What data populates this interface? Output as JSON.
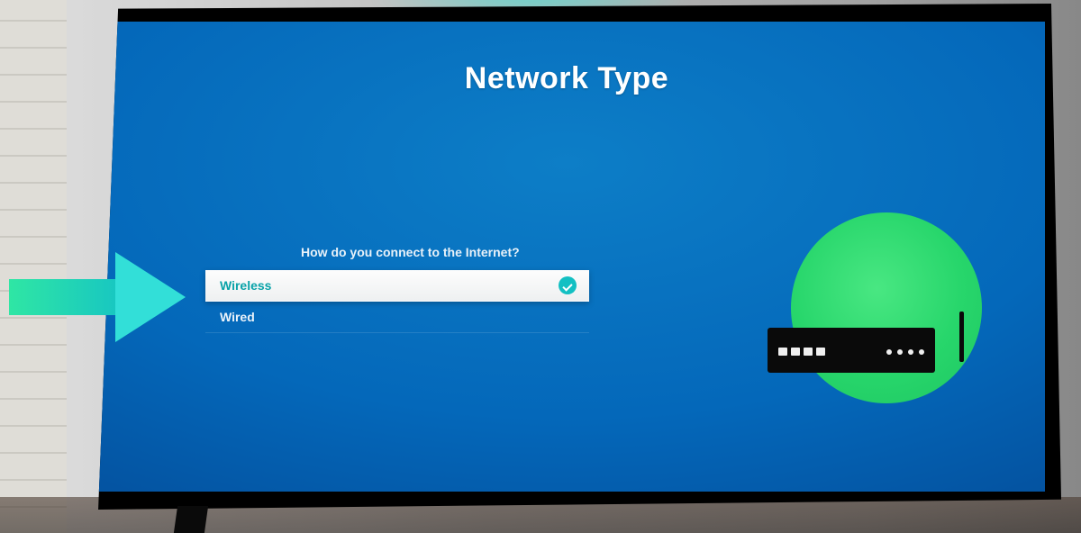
{
  "header": {
    "title": "Network Type"
  },
  "prompt": "How do you connect to the Internet?",
  "options": [
    {
      "label": "Wireless",
      "selected": true
    },
    {
      "label": "Wired",
      "selected": false
    }
  ],
  "illustration": {
    "icon": "router-icon"
  },
  "annotation": {
    "arrow": "pointer-arrow"
  }
}
